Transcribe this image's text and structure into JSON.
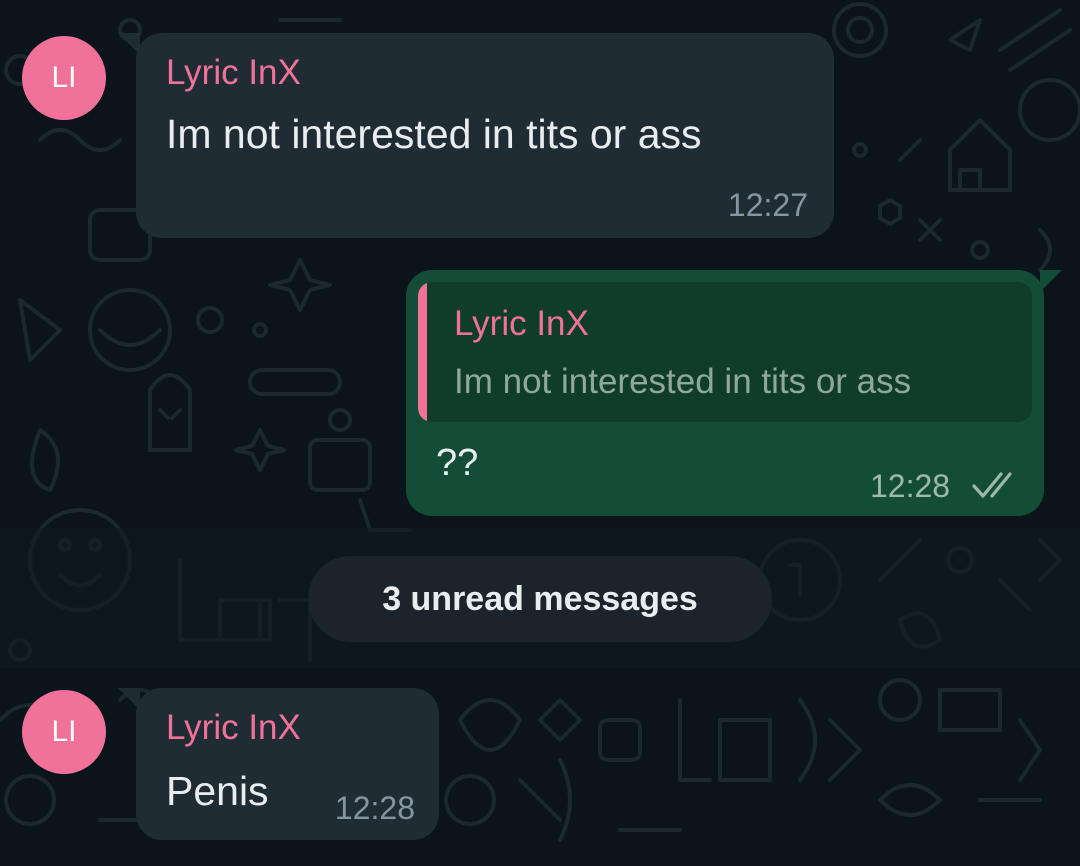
{
  "messages": [
    {
      "direction": "incoming",
      "avatar_initials": "LI",
      "sender": "Lyric InX",
      "text": "Im not interested in tits or ass",
      "time": "12:27"
    },
    {
      "direction": "outgoing",
      "quote": {
        "sender": "Lyric InX",
        "text": "Im not interested in tits or ass"
      },
      "text": "??",
      "time": "12:28",
      "status_icon": "double-check-icon"
    },
    {
      "direction": "incoming",
      "avatar_initials": "LI",
      "sender": "Lyric InX",
      "text": "Penis",
      "time": "12:28"
    }
  ],
  "unread_divider": {
    "label": "3 unread messages"
  },
  "colors": {
    "background": "#0b141a",
    "incoming_bubble": "#202c33",
    "outgoing_bubble": "#144d37",
    "sender_name": "#f0729b",
    "avatar": "#f0729b",
    "timestamp": "#8696a0"
  }
}
